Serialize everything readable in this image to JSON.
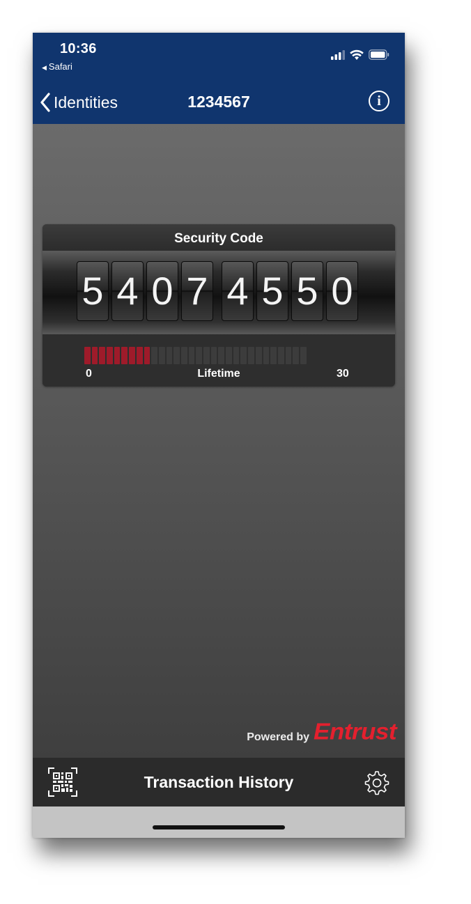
{
  "status_bar": {
    "time": "10:36",
    "back_app": "Safari"
  },
  "nav": {
    "back_label": "Identities",
    "title": "1234567",
    "info_label": "i"
  },
  "token": {
    "card_title": "Security Code",
    "digits": [
      "5",
      "4",
      "0",
      "7",
      "4",
      "5",
      "5",
      "0"
    ],
    "lifetime": {
      "label": "Lifetime",
      "min_label": "0",
      "max_label": "30",
      "total_segments": 30,
      "filled_segments": 9,
      "fill_color": "#9e1b2a"
    }
  },
  "branding": {
    "powered_by": "Powered by",
    "brand": "Entrust",
    "brand_color": "#e4202e"
  },
  "toolbar": {
    "qr_icon": "qr-code-scanner-icon",
    "transaction_history": "Transaction History",
    "settings_icon": "gear-icon"
  },
  "colors": {
    "header_bg": "#10356e",
    "toolbar_bg": "#2b2b2b"
  }
}
